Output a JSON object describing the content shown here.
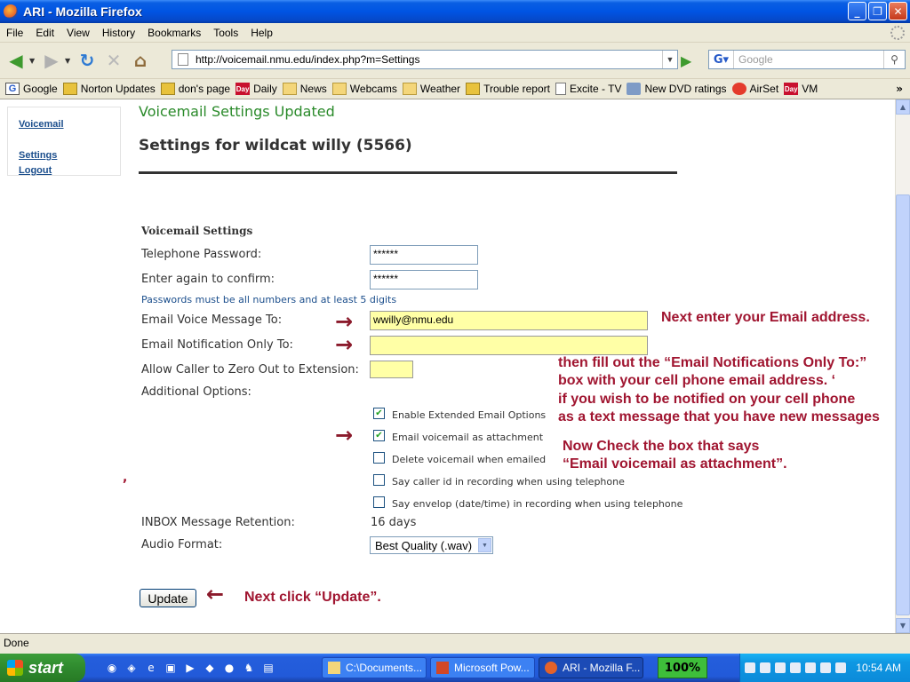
{
  "window": {
    "title": "ARI - Mozilla Firefox"
  },
  "menu": [
    "File",
    "Edit",
    "View",
    "History",
    "Bookmarks",
    "Tools",
    "Help"
  ],
  "toolbar": {
    "url": "http://voicemail.nmu.edu/index.php?m=Settings",
    "search_placeholder": "Google"
  },
  "bookmarks": [
    {
      "label": "Google",
      "icon": "g"
    },
    {
      "label": "Norton Updates",
      "icon": "rss"
    },
    {
      "label": "don's page",
      "icon": "rss"
    },
    {
      "label": "Daily",
      "icon": "day"
    },
    {
      "label": "News",
      "icon": "folder"
    },
    {
      "label": "Webcams",
      "icon": "folder"
    },
    {
      "label": "Weather",
      "icon": "folder"
    },
    {
      "label": "Trouble report",
      "icon": "rss"
    },
    {
      "label": "Excite - TV",
      "icon": "doc"
    },
    {
      "label": "New DVD ratings",
      "icon": "dvd"
    },
    {
      "label": "AirSet",
      "icon": "air"
    },
    {
      "label": "VM",
      "icon": "day"
    }
  ],
  "bookmark_day_badge": "Day",
  "bookmark_more": "»",
  "sidenav": {
    "voicemail": "Voicemail",
    "settings": "Settings",
    "logout": "Logout"
  },
  "page": {
    "notice": "Voicemail Settings Updated",
    "heading": "Settings for wildcat willy (5566)",
    "section_title": "Voicemail Settings",
    "labels": {
      "telephone_password": "Telephone Password:",
      "confirm": "Enter again to confirm:",
      "hint": "Passwords must be all numbers and at least 5 digits",
      "email_voice": "Email Voice Message To:",
      "email_notify": "Email Notification Only To:",
      "zero_out": "Allow Caller to Zero Out to Extension:",
      "additional": "Additional Options:",
      "retention": "INBOX Message Retention:",
      "audio_format": "Audio Format:"
    },
    "values": {
      "telephone_password": "******",
      "confirm": "******",
      "email_voice": "wwilly@nmu.edu",
      "email_notify": "",
      "zero_out": "",
      "retention": "16 days",
      "audio_format": "Best Quality (.wav)"
    },
    "options": [
      {
        "label": "Enable Extended Email Options",
        "checked": true
      },
      {
        "label": "Email voicemail as attachment",
        "checked": true
      },
      {
        "label": "Delete voicemail when emailed",
        "checked": false
      },
      {
        "label": "Say caller id in recording when using telephone",
        "checked": false
      },
      {
        "label": "Say envelop (date/time) in recording when using telephone",
        "checked": false
      }
    ],
    "update_label": "Update"
  },
  "annotations": {
    "email": "Next enter your Email address.",
    "notify": [
      "then fill out the “Email Notifications Only To:”",
      "box with your cell phone email address. ‘",
      "if you wish to be notified on your cell phone",
      "as a text message that you have new messages"
    ],
    "attach": [
      "Now Check the box that says",
      "“Email voicemail as attachment”."
    ],
    "update": "Next click “Update”.",
    "stray_mark": ","
  },
  "status": "Done",
  "taskbar": {
    "start": "start",
    "buttons": [
      "C:\\Documents...",
      "Microsoft Pow...",
      "ARI - Mozilla F..."
    ],
    "zoom": "100%",
    "clock": "10:54 AM"
  },
  "colors": {
    "annotation": "#A01530",
    "notice": "#2A8A2A",
    "highlight": "#FFFFA6"
  }
}
